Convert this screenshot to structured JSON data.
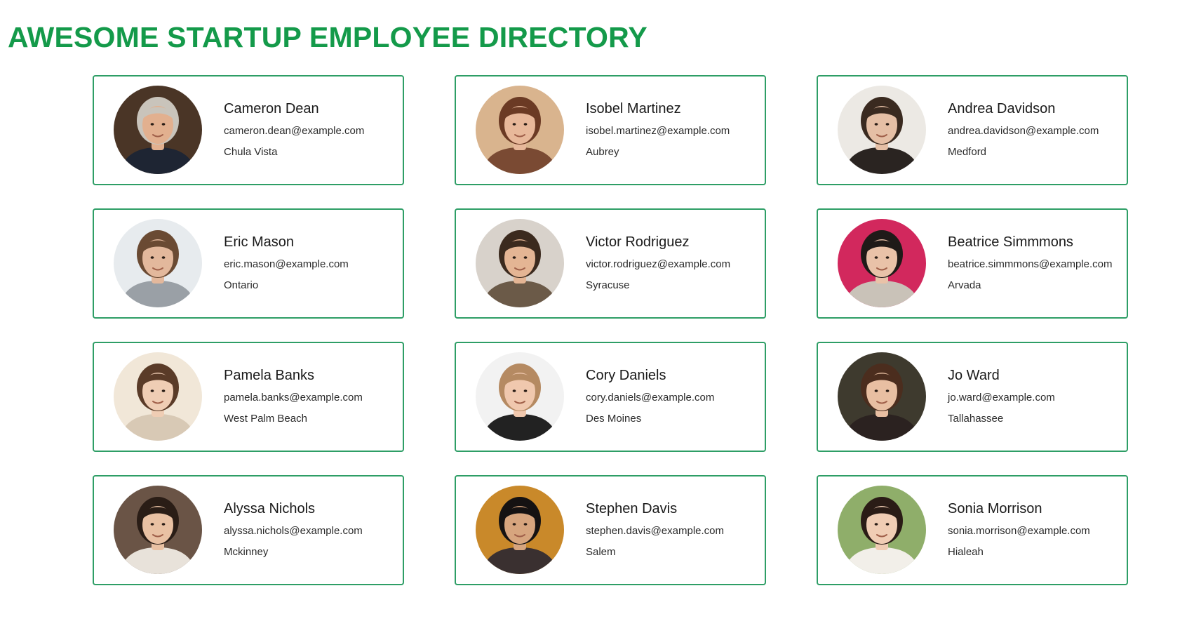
{
  "header": {
    "title": "AWESOME STARTUP EMPLOYEE DIRECTORY"
  },
  "colors": {
    "accent": "#149a4a",
    "card_border": "#2e9e66"
  },
  "employees": [
    {
      "name": "Cameron Dean",
      "email": "cameron.dean@example.com",
      "city": "Chula Vista",
      "bg": "#4a3526",
      "skin": "#e2b08f",
      "hair": "#c9c4bb",
      "shirt": "#1e2533"
    },
    {
      "name": "Isobel Martinez",
      "email": "isobel.martinez@example.com",
      "city": "Aubrey",
      "bg": "#d9b48e",
      "skin": "#e8b89a",
      "hair": "#6b3a24",
      "shirt": "#7a4a33"
    },
    {
      "name": "Andrea Davidson",
      "email": "andrea.davidson@example.com",
      "city": "Medford",
      "bg": "#ece9e4",
      "skin": "#e5bfa5",
      "hair": "#3a2a20",
      "shirt": "#2a2421"
    },
    {
      "name": "Eric Mason",
      "email": "eric.mason@example.com",
      "city": "Ontario",
      "bg": "#e7ebee",
      "skin": "#e3b89c",
      "hair": "#6a4a33",
      "shirt": "#9aa0a6"
    },
    {
      "name": "Victor Rodriguez",
      "email": "victor.rodriguez@example.com",
      "city": "Syracuse",
      "bg": "#d8d2cb",
      "skin": "#e4b594",
      "hair": "#3b2a1e",
      "shirt": "#6b5a48"
    },
    {
      "name": "Beatrice Simmmons",
      "email": "beatrice.simmmons@example.com",
      "city": "Arvada",
      "bg": "#d2285d",
      "skin": "#e9c2a8",
      "hair": "#1f1a18",
      "shirt": "#c9c2b8"
    },
    {
      "name": "Pamela Banks",
      "email": "pamela.banks@example.com",
      "city": "West Palm Beach",
      "bg": "#f1e7d8",
      "skin": "#efcdb4",
      "hair": "#5a3b28",
      "shirt": "#d8c9b5"
    },
    {
      "name": "Cory Daniels",
      "email": "cory.daniels@example.com",
      "city": "Des Moines",
      "bg": "#f2f2f2",
      "skin": "#f0c8ae",
      "hair": "#b58a62",
      "shirt": "#222222"
    },
    {
      "name": "Jo Ward",
      "email": "jo.ward@example.com",
      "city": "Tallahassee",
      "bg": "#3e3a2e",
      "skin": "#e8bfa2",
      "hair": "#4b2d1e",
      "shirt": "#2b2220"
    },
    {
      "name": "Alyssa Nichols",
      "email": "alyssa.nichols@example.com",
      "city": "Mckinney",
      "bg": "#6a5446",
      "skin": "#e9c1a3",
      "hair": "#2a1d16",
      "shirt": "#e8e2da"
    },
    {
      "name": "Stephen Davis",
      "email": "stephen.davis@example.com",
      "city": "Salem",
      "bg": "#c9892a",
      "skin": "#d7a57e",
      "hair": "#151212",
      "shirt": "#3a3030"
    },
    {
      "name": "Sonia Morrison",
      "email": "sonia.morrison@example.com",
      "city": "Hialeah",
      "bg": "#8fae6a",
      "skin": "#f0cdb4",
      "hair": "#2a1c16",
      "shirt": "#f2efe9"
    }
  ]
}
